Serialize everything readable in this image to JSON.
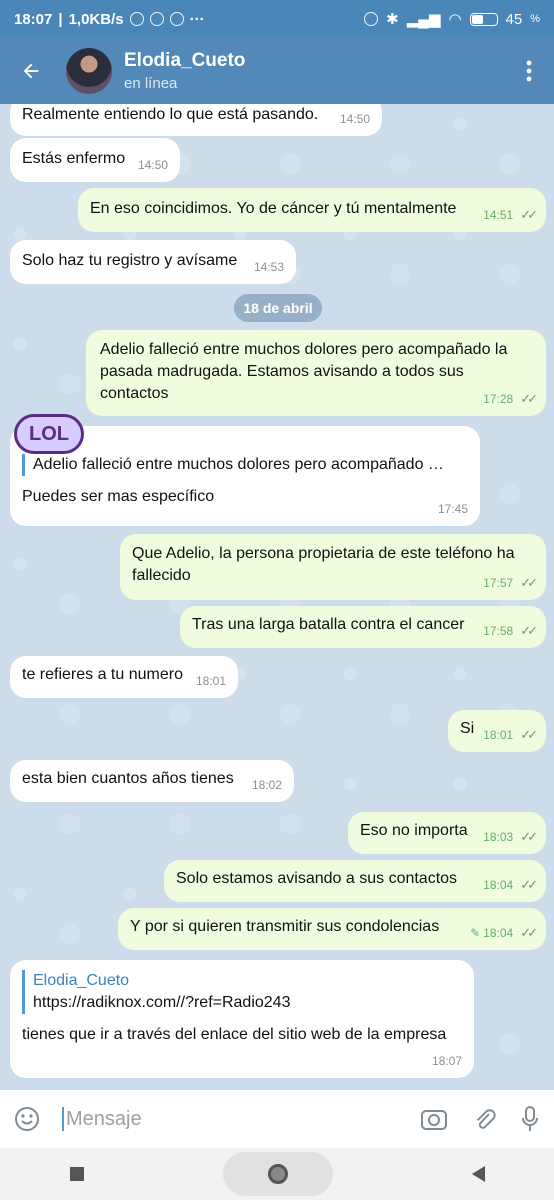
{
  "statusbar": {
    "time": "18:07",
    "net": "1,0KB/s",
    "battery": "45"
  },
  "header": {
    "name": "Elodia_Cueto",
    "status": "en línea",
    "icons": {
      "back": "arrow-left-icon",
      "menu": "kebab-menu-icon"
    }
  },
  "date_pill": "18 de abril",
  "messages": [
    {
      "dir": "in",
      "text": "Realmente entiendo lo que está pasando.",
      "time": "14:50"
    },
    {
      "dir": "in",
      "text": "Estás enfermo",
      "time": "14:50"
    },
    {
      "dir": "out",
      "text": "En eso coincidimos. Yo de cáncer y tú mentalmente",
      "time": "14:51"
    },
    {
      "dir": "in",
      "text": "Solo haz tu registro y avísame",
      "time": "14:53"
    },
    {
      "dir": "out",
      "text": "Adelio falleció entre muchos dolores pero acompañado la pasada madrugada. Estamos avisando a todos sus contactos",
      "time": "17:28"
    },
    {
      "dir": "in",
      "reply_quote": "Adelio falleció entre muchos dolores pero acompañado …",
      "sticker": "LOL",
      "text": "Puedes ser mas específico",
      "time": "17:45"
    },
    {
      "dir": "out",
      "text": "Que Adelio, la persona propietaria de este teléfono ha fallecido",
      "time": "17:57"
    },
    {
      "dir": "out",
      "text": "Tras una larga batalla contra el cancer",
      "time": "17:58"
    },
    {
      "dir": "in",
      "text": "te refieres a tu numero",
      "time": "18:01"
    },
    {
      "dir": "out",
      "text": "Si",
      "time": "18:01"
    },
    {
      "dir": "in",
      "text": "esta bien cuantos años tienes",
      "time": "18:02"
    },
    {
      "dir": "out",
      "text": "Eso no importa",
      "time": "18:03"
    },
    {
      "dir": "out",
      "text": "Solo estamos avisando a sus contactos",
      "time": "18:04"
    },
    {
      "dir": "out",
      "text": "Y por si quieren transmitir sus condolencias",
      "time": "18:04"
    },
    {
      "dir": "in",
      "reply_name": "Elodia_Cueto",
      "reply_quote": "https://radiknox.com//?ref=Radio243",
      "text": "tienes que ir a través del enlace del sitio web de la empresa",
      "time": "18:07"
    }
  ],
  "composer": {
    "placeholder": "Mensaje",
    "icons": [
      "emoji-icon",
      "camera-icon",
      "attach-icon",
      "mic-icon"
    ]
  },
  "colors": {
    "header": "#5289b8",
    "outgoing": "#effdde",
    "incoming": "#ffffff",
    "accent": "#4f9ad6"
  }
}
